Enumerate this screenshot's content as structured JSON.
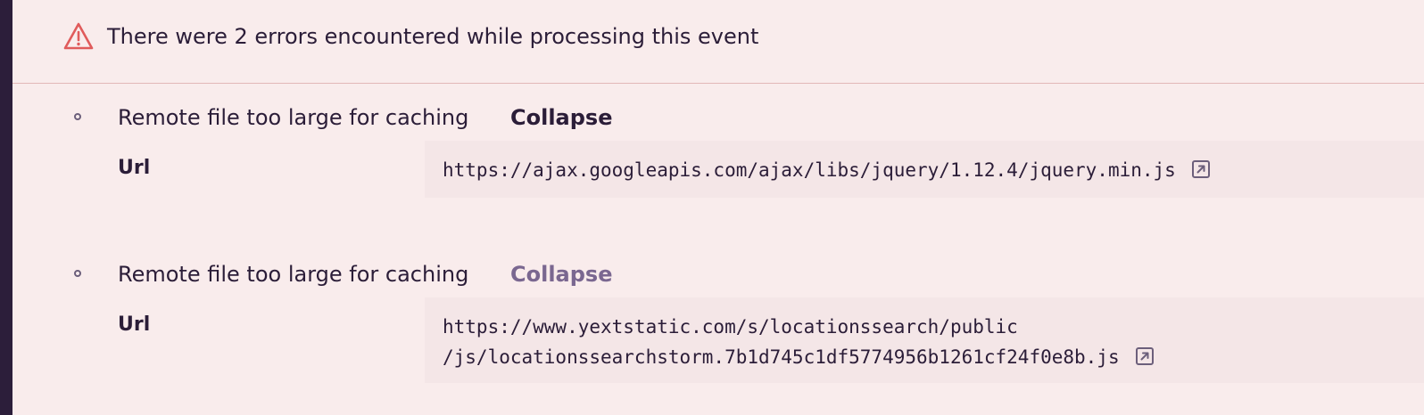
{
  "alert": {
    "title": "There were 2 errors encountered while processing this event",
    "icon": "warning-icon",
    "icon_color": "#e05b5b"
  },
  "errors": [
    {
      "message": "Remote file too large for caching",
      "toggle_label": "Collapse",
      "key": "Url",
      "url_line1": "https://ajax.googleapis.com/ajax/libs/jquery/1.12.4/jquery.min.js",
      "url_line2": ""
    },
    {
      "message": "Remote file too large for caching",
      "toggle_label": "Collapse",
      "key": "Url",
      "url_line1": "https://www.yextstatic.com/s/locationssearch/public",
      "url_line2": "/js/locationssearchstorm.7b1d745c1df5774956b1261cf24f0e8b.js"
    }
  ],
  "colors": {
    "background": "#f9ecec",
    "text": "#2b1d38",
    "link_muted": "#7a6790",
    "rail": "#2c1e3a"
  }
}
